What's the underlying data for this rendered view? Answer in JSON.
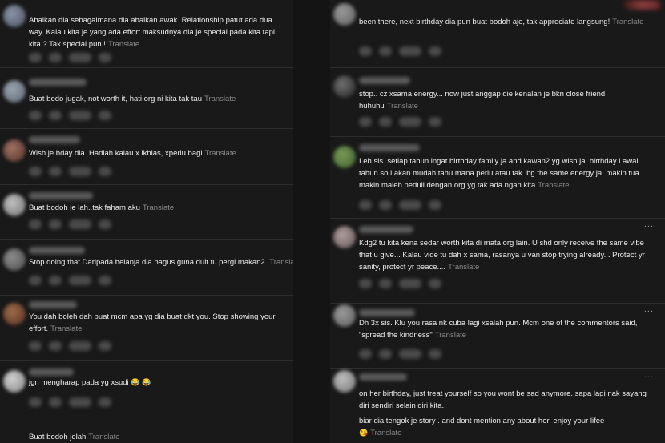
{
  "left_comments": [
    {
      "text": "Abaikan dia sebagaimana dia abaikan awak. Relationship patut ada dua way. Kalau kita je yang ada effort maksudnya dia je special pada kita tapi kita ? Tak special pun !",
      "translate": "Translate"
    },
    {
      "text": "Buat bodo jugak, not worth it, hati org ni kita tak tau",
      "translate": "Translate"
    },
    {
      "text": "Wish je bday dia. Hadiah kalau x ikhlas, xperlu bagi",
      "translate": "Translate"
    },
    {
      "text": "Buat bodoh je lah..tak faham aku",
      "translate": "Translate"
    },
    {
      "text": "Stop doing that.Daripada belanja dia bagus guna duit tu pergi makan2.",
      "translate": "Translate"
    },
    {
      "text": "You dah boleh dah buat mcm apa yg dia buat dkt you. Stop showing your effort.",
      "translate": "Translate"
    },
    {
      "text": "jgn mengharap pada yg xsudi",
      "emoji": "😂 😂",
      "translate": ""
    },
    {
      "text": "Buat bodoh jelah",
      "translate": "Translate"
    }
  ],
  "right_comments": [
    {
      "text": "been there, next birthday dia pun buat bodoh aje, tak appreciate langsung!",
      "translate": "Translate"
    },
    {
      "text": "stop.. cz xsama energy... now just anggap die kenalan je bkn close friend huhuhu",
      "translate": "Translate"
    },
    {
      "text": "I eh sis..setiap tahun ingat birthday family ja and kawan2 yg wish ja..birthday i awal tahun so i akan mudah tahu mana perlu atau tak..bg the same energy ja..makin tua makin maleh peduli dengan org yg tak ada ngan kita",
      "translate": "Translate"
    },
    {
      "text": "Kdg2 tu kita kena sedar worth kita di mata org lain. U shd only receive the same vibe that u give... Kalau vide tu dah x sama, rasanya u van stop trying already... Protect yr sanity, protect yr peace....",
      "translate": "Translate"
    },
    {
      "text": "Dh 3x sis. Klu you rasa nk cuba lagi xsalah pun. Mcm one of the commentors said, \"spread the kindness\"",
      "translate": "Translate"
    },
    {
      "text": "on her birthday, just treat yourself so you wont be sad anymore. sapa lagi nak sayang diri sendiri selain diri kita.",
      "translate": ""
    }
  ],
  "right_extra": {
    "text": "biar dia tengok je story . and dont mention any about her, enjoy your lifee",
    "emoji": "😘",
    "translate": "Translate"
  },
  "more_glyph": "...",
  "colors": {
    "background": "#191919",
    "text": "#ececec",
    "translate": "#8a8a8a",
    "divider": "#2d2d2d"
  }
}
